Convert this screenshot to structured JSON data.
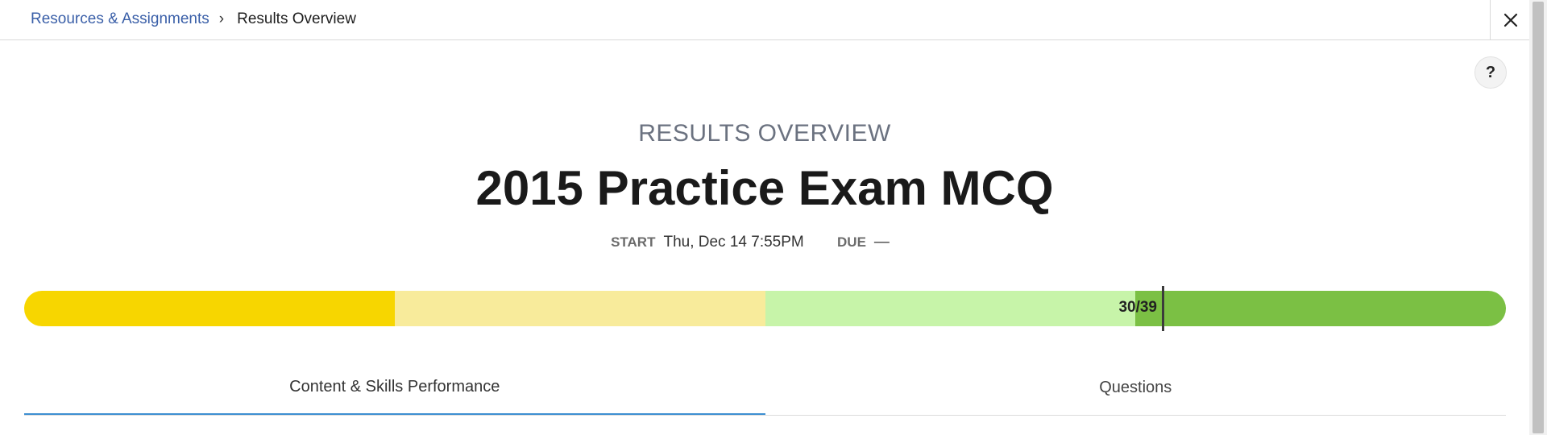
{
  "breadcrumb": {
    "link": "Resources & Assignments",
    "separator": "›",
    "current": "Results Overview"
  },
  "header": {
    "close_icon": "close-icon",
    "help_label": "?"
  },
  "overview": {
    "label": "RESULTS OVERVIEW",
    "title": "2015 Practice Exam MCQ",
    "start_key": "START",
    "start_value": "Thu, Dec 14 7:55PM",
    "due_key": "DUE",
    "due_value": "—"
  },
  "score": {
    "text": "30/39",
    "correct": 30,
    "total": 39,
    "segment_colors": [
      "#f7d600",
      "#f8eb9b",
      "#c7f4a9",
      "#7bc044"
    ]
  },
  "tabs": [
    {
      "label": "Content & Skills Performance",
      "active": true
    },
    {
      "label": "Questions",
      "active": false
    }
  ]
}
